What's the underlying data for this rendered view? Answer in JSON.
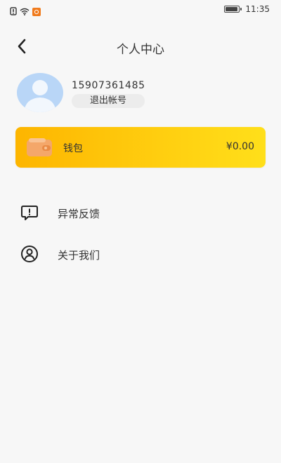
{
  "status_bar": {
    "time": "11:35",
    "battery_percent": 90
  },
  "header": {
    "title": "个人中心",
    "back_icon": "chevron-left-icon"
  },
  "profile": {
    "phone": "15907361485",
    "logout_label": "退出帐号",
    "avatar_icon": "user-avatar-icon"
  },
  "wallet": {
    "label": "钱包",
    "balance": "¥0.00",
    "icon": "wallet-icon",
    "gradient_start": "#fdb500",
    "gradient_end": "#ffdf1a"
  },
  "menu": {
    "items": [
      {
        "label": "异常反馈",
        "icon": "feedback-icon"
      },
      {
        "label": "关于我们",
        "icon": "about-us-icon"
      }
    ]
  }
}
